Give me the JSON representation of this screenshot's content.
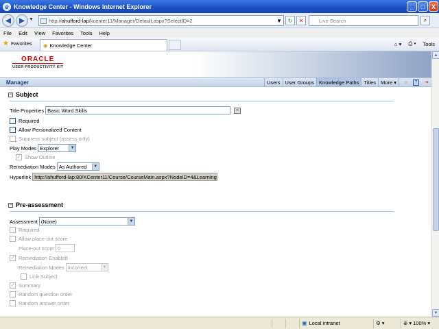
{
  "window": {
    "title": "Knowledge Center - Windows Internet Explorer",
    "min_label": "_",
    "max_label": "□",
    "close_label": "X"
  },
  "address": {
    "url_prefix": "http://",
    "url_host": "ahufford-lap",
    "url_path": "/kcenter11/Manager/Default.aspx?SelectID=2",
    "search_placeholder": "Live Search"
  },
  "menu": [
    "File",
    "Edit",
    "View",
    "Favorites",
    "Tools",
    "Help"
  ],
  "favbar": {
    "favorites_label": "Favorites",
    "tab_label": "Knowledge Center",
    "tools_label": "Tools"
  },
  "app": {
    "logo_text": "ORACLE",
    "logo_sub": "USER PRODUCTIVITY KIT",
    "manager_label": "Manager",
    "nav_tabs": [
      {
        "label": "Users",
        "active": false
      },
      {
        "label": "User Groups",
        "active": false
      },
      {
        "label": "Knowledge Paths",
        "active": true
      },
      {
        "label": "Titles",
        "active": false
      },
      {
        "label": "More",
        "active": false
      }
    ]
  },
  "subject": {
    "heading": "Subject",
    "toggle": "−",
    "title_properties_label": "Title Properties",
    "title_value": "Basic Word Skills",
    "required_label": "Required",
    "allow_personalized_label": "Allow Personalized Content",
    "suppress_label": "Suppress subject (assess only)",
    "play_modes_label": "Play Modes",
    "play_modes_value": "Explorer",
    "show_outline_label": "Show Outline",
    "remediation_modes_label": "Remediation Modes",
    "remediation_modes_value": "As Authored",
    "hyperlink_label": "Hyperlink",
    "hyperlink_value": "http://ahufford-lap:80/KCenter11/Course/CourseMain.aspx?NodeID=4&Learning"
  },
  "preassessment": {
    "heading": "Pre-assessment",
    "toggle": "−",
    "assessment_label": "Assessment",
    "assessment_value": "(None)",
    "required_label": "Required",
    "allow_placeout_label": "Allow place-out score",
    "placeout_score_label": "Place-out score",
    "placeout_score_value": "0",
    "remediation_enabled_label": "Remediation Enabled",
    "remediation_modes_label": "Remediation Modes",
    "remediation_modes_value": "Incorrect",
    "link_subject_label": "Link Subject",
    "summary_label": "Summary",
    "random_question_label": "Random question order",
    "random_answer_label": "Random answer order"
  },
  "status": {
    "zone": "Local intranet",
    "zoom": "100%"
  }
}
